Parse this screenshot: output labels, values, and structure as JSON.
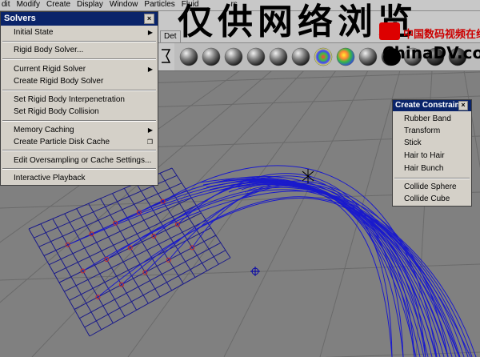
{
  "menubar": {
    "items": [
      "dit",
      "Modify",
      "Create",
      "Display",
      "Window",
      "Particles",
      "Fluid",
      "",
      "",
      "",
      "",
      "rs"
    ]
  },
  "shelf_tab_label": "Det",
  "solvers_menu": {
    "title": "Solvers",
    "items": [
      {
        "label": "Initial State",
        "submenu": true
      },
      {
        "label": "Rigid Body Solver...",
        "submenu": false
      },
      {
        "label": "Current Rigid Solver",
        "submenu": true
      },
      {
        "label": "Create Rigid Body Solver",
        "submenu": false
      },
      {
        "label": "Set Rigid Body Interpenetration",
        "submenu": false
      },
      {
        "label": "Set Rigid Body Collision",
        "submenu": false
      },
      {
        "label": "Memory Caching",
        "submenu": true
      },
      {
        "label": "Create Particle Disk Cache",
        "submenu": false,
        "option_box": true
      },
      {
        "label": "Edit Oversampling or Cache Settings...",
        "submenu": false
      },
      {
        "label": "Interactive Playback",
        "submenu": false
      }
    ]
  },
  "constraint_menu": {
    "title": "Create Constraint",
    "items": [
      "Rubber Band",
      "Transform",
      "Stick",
      "Hair to Hair",
      "Hair Bunch",
      "Collide Sphere",
      "Collide Cube"
    ]
  },
  "watermark_text": "仅供网络浏览",
  "logo": {
    "cn_text": "中国数码视频在线",
    "en_text": "ChinaDV.com"
  },
  "colors": {
    "viewport_bg": "#7f7f7f",
    "grid_line": "#1a1a8a",
    "hair_curve": "#1a1acc",
    "vertex_marker": "#cc2222",
    "menu_bg": "#d4d0c8",
    "title_bg": "#0a246a"
  }
}
